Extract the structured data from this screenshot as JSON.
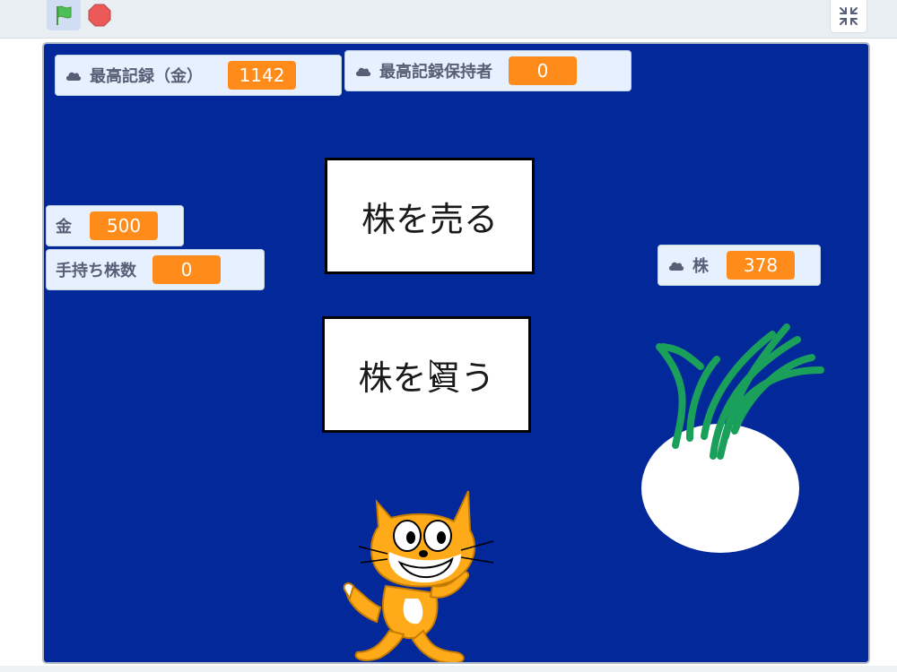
{
  "toolbar": {
    "green_flag_icon": "green-flag-icon",
    "stop_icon": "stop-sign-icon",
    "fullscreen_icon": "exit-fullscreen-icon"
  },
  "monitors": {
    "high_score": {
      "label": "最高記録（金）",
      "value": "1142",
      "cloud": true
    },
    "record_holder": {
      "label": "最高記録保持者",
      "value": "0",
      "cloud": true
    },
    "money": {
      "label": "金",
      "value": "500",
      "cloud": false
    },
    "shares_held": {
      "label": "手持ち株数",
      "value": "0",
      "cloud": false
    },
    "stock": {
      "label": "株",
      "value": "378",
      "cloud": true
    }
  },
  "buttons": {
    "sell": "株を売る",
    "buy": "株を買う"
  },
  "colors": {
    "stage_bg": "#03289a",
    "monitor_bg": "#e6f0ff",
    "monitor_value": "#ff8c1a",
    "turnip_leaves": "#1aa05a"
  }
}
